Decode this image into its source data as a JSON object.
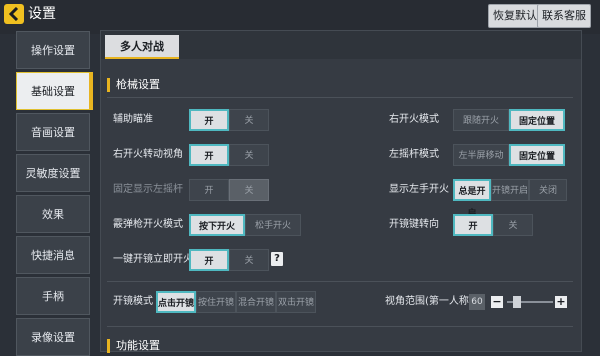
{
  "header": {
    "title": "设置",
    "restore_default": "恢复默认",
    "contact_service": "联系客服"
  },
  "sidebar": {
    "items": [
      {
        "label": "操作设置",
        "active": false
      },
      {
        "label": "基础设置",
        "active": true
      },
      {
        "label": "音画设置",
        "active": false
      },
      {
        "label": "灵敏度设置",
        "active": false
      },
      {
        "label": "效果",
        "active": false
      },
      {
        "label": "快捷消息",
        "active": false
      },
      {
        "label": "手柄",
        "active": false
      },
      {
        "label": "录像设置",
        "active": false
      }
    ]
  },
  "tabs": {
    "active_label": "多人对战"
  },
  "gun_section": {
    "title": "枪械设置",
    "aim_assist": {
      "label": "辅助瞄准",
      "on": "开",
      "off": "关",
      "selected": "on"
    },
    "right_fire_turn": {
      "label": "右开火转动视角",
      "on": "开",
      "off": "关",
      "selected": "on"
    },
    "fixed_left_stick": {
      "label": "固定显示左摇杆",
      "on": "开",
      "off": "关",
      "selected": "off",
      "disabled": true
    },
    "shotgun_fire_mode": {
      "label": "霰弹枪开火模式",
      "press": "按下开火",
      "release": "松手开火",
      "selected": "press"
    },
    "scope_instant_fire": {
      "label": "一键开镜立即开火",
      "on": "开",
      "off": "关",
      "selected": "on",
      "help": "?"
    },
    "right_fire_mode": {
      "label": "右开火模式",
      "follow": "跟随开火",
      "fixed": "固定位置",
      "selected": "fixed"
    },
    "left_stick_mode": {
      "label": "左摇杆模式",
      "half_screen": "左半屏移动",
      "fixed": "固定位置",
      "selected": "fixed"
    },
    "show_left_fire": {
      "label": "显示左手开火",
      "always": "总是开启",
      "scoped": "开镜开启",
      "off": "关闭",
      "selected": "always"
    },
    "scope_turn": {
      "label": "开镜键转向",
      "on": "开",
      "off": "关",
      "selected": "on"
    }
  },
  "scope_mode": {
    "label": "开镜模式",
    "options": [
      "点击开镜",
      "按住开镜",
      "混合开镜",
      "双击开镜"
    ],
    "selected": 0
  },
  "fov": {
    "label": "视角范围(第一人称)",
    "value": "60",
    "level": 0.15,
    "minus": "−",
    "plus": "+"
  },
  "function_section": {
    "title": "功能设置"
  }
}
